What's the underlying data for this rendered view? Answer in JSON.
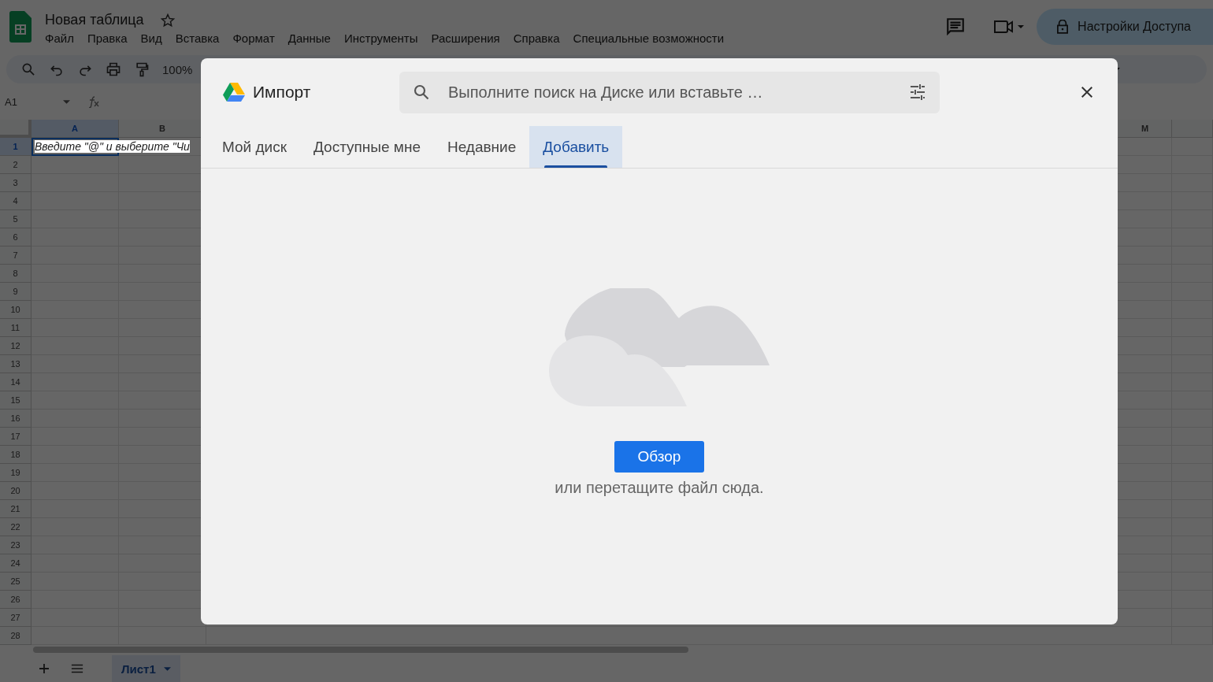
{
  "app": {
    "title": "Новая таблица",
    "menu": [
      "Файл",
      "Правка",
      "Вид",
      "Вставка",
      "Формат",
      "Данные",
      "Инструменты",
      "Расширения",
      "Справка",
      "Специальные возможности"
    ],
    "share_button": "Настройки Доступа"
  },
  "toolbar": {
    "zoom": "100%"
  },
  "formula_bar": {
    "cell_reference": "A1"
  },
  "sheet": {
    "columns": [
      {
        "label": "A",
        "selected": true
      },
      {
        "label": "B",
        "selected": false
      },
      {
        "label": "M",
        "selected": false
      }
    ],
    "rows": [
      {
        "label": "1",
        "selected": true
      },
      {
        "label": "2",
        "selected": false
      },
      {
        "label": "3",
        "selected": false
      },
      {
        "label": "4",
        "selected": false
      },
      {
        "label": "5",
        "selected": false
      },
      {
        "label": "6",
        "selected": false
      },
      {
        "label": "7",
        "selected": false
      },
      {
        "label": "8",
        "selected": false
      },
      {
        "label": "9",
        "selected": false
      },
      {
        "label": "10",
        "selected": false
      },
      {
        "label": "11",
        "selected": false
      },
      {
        "label": "12",
        "selected": false
      },
      {
        "label": "13",
        "selected": false
      },
      {
        "label": "14",
        "selected": false
      },
      {
        "label": "15",
        "selected": false
      },
      {
        "label": "16",
        "selected": false
      },
      {
        "label": "17",
        "selected": false
      },
      {
        "label": "18",
        "selected": false
      },
      {
        "label": "19",
        "selected": false
      },
      {
        "label": "20",
        "selected": false
      },
      {
        "label": "21",
        "selected": false
      },
      {
        "label": "22",
        "selected": false
      },
      {
        "label": "23",
        "selected": false
      },
      {
        "label": "24",
        "selected": false
      },
      {
        "label": "25",
        "selected": false
      },
      {
        "label": "26",
        "selected": false
      },
      {
        "label": "27",
        "selected": false
      },
      {
        "label": "28",
        "selected": false
      }
    ],
    "cell_a1": "Введите \"@\" и выберите \"Чи"
  },
  "sheet_tabs": [
    {
      "label": "Лист1",
      "selected": true
    }
  ],
  "dialog": {
    "title": "Импорт",
    "search": {
      "placeholder": "Выполните поиск на Диске или вставьте …"
    },
    "tabs": [
      {
        "label": "Мой диск",
        "selected": false
      },
      {
        "label": "Доступные мне",
        "selected": false
      },
      {
        "label": "Недавние",
        "selected": false
      },
      {
        "label": "Добавить",
        "selected": true
      }
    ],
    "browse_button": "Обзор",
    "hint": "или перетащите файл сюда."
  }
}
